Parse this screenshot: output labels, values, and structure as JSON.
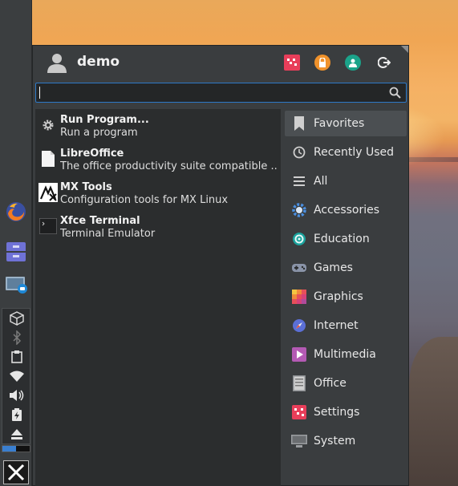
{
  "user": {
    "name": "demo"
  },
  "search": {
    "value": "",
    "placeholder": ""
  },
  "apps": [
    {
      "name": "Run Program...",
      "description": "Run a program",
      "icon": "gear-icon"
    },
    {
      "name": "LibreOffice",
      "description": "The office productivity suite compatible ...",
      "icon": "document-icon"
    },
    {
      "name": "MX Tools",
      "description": "Configuration tools for MX Linux",
      "icon": "mx-logo-icon"
    },
    {
      "name": "Xfce Terminal",
      "description": "Terminal Emulator",
      "icon": "terminal-icon"
    }
  ],
  "categories": [
    {
      "label": "Favorites",
      "icon": "bookmark-icon",
      "active": true
    },
    {
      "label": "Recently Used",
      "icon": "clock-icon",
      "active": false
    },
    {
      "label": "All",
      "icon": "list-icon",
      "active": false
    },
    {
      "label": "Accessories",
      "icon": "accessories-icon",
      "active": false
    },
    {
      "label": "Education",
      "icon": "education-icon",
      "active": false
    },
    {
      "label": "Games",
      "icon": "gamepad-icon",
      "active": false
    },
    {
      "label": "Graphics",
      "icon": "graphics-icon",
      "active": false
    },
    {
      "label": "Internet",
      "icon": "internet-icon",
      "active": false
    },
    {
      "label": "Multimedia",
      "icon": "multimedia-icon",
      "active": false
    },
    {
      "label": "Office",
      "icon": "office-icon",
      "active": false
    },
    {
      "label": "Settings",
      "icon": "settings-icon",
      "active": false
    },
    {
      "label": "System",
      "icon": "system-icon",
      "active": false
    }
  ],
  "header_actions": [
    {
      "name": "settings-manager-button",
      "icon": "settings-manager-icon",
      "color": "#e83e5a"
    },
    {
      "name": "lock-screen-button",
      "icon": "lock-icon",
      "color": "#f0922b"
    },
    {
      "name": "switch-user-button",
      "icon": "user-switch-icon",
      "color": "#1ba38a"
    },
    {
      "name": "logout-button",
      "icon": "logout-icon",
      "color": "#e6e6e6"
    }
  ],
  "panel": {
    "launchers": [
      "firefox-icon",
      "file-manager-icon",
      "screenshot-icon"
    ],
    "tray": [
      "package-icon",
      "bluetooth-icon",
      "clipboard-icon",
      "wifi-icon",
      "volume-icon",
      "battery-icon",
      "eject-icon"
    ],
    "cpu_usage": 0.5
  },
  "colors": {
    "accent": "#2d79c7",
    "menu_bg": "#3a3d3f",
    "list_bg": "#2b2d2e"
  }
}
